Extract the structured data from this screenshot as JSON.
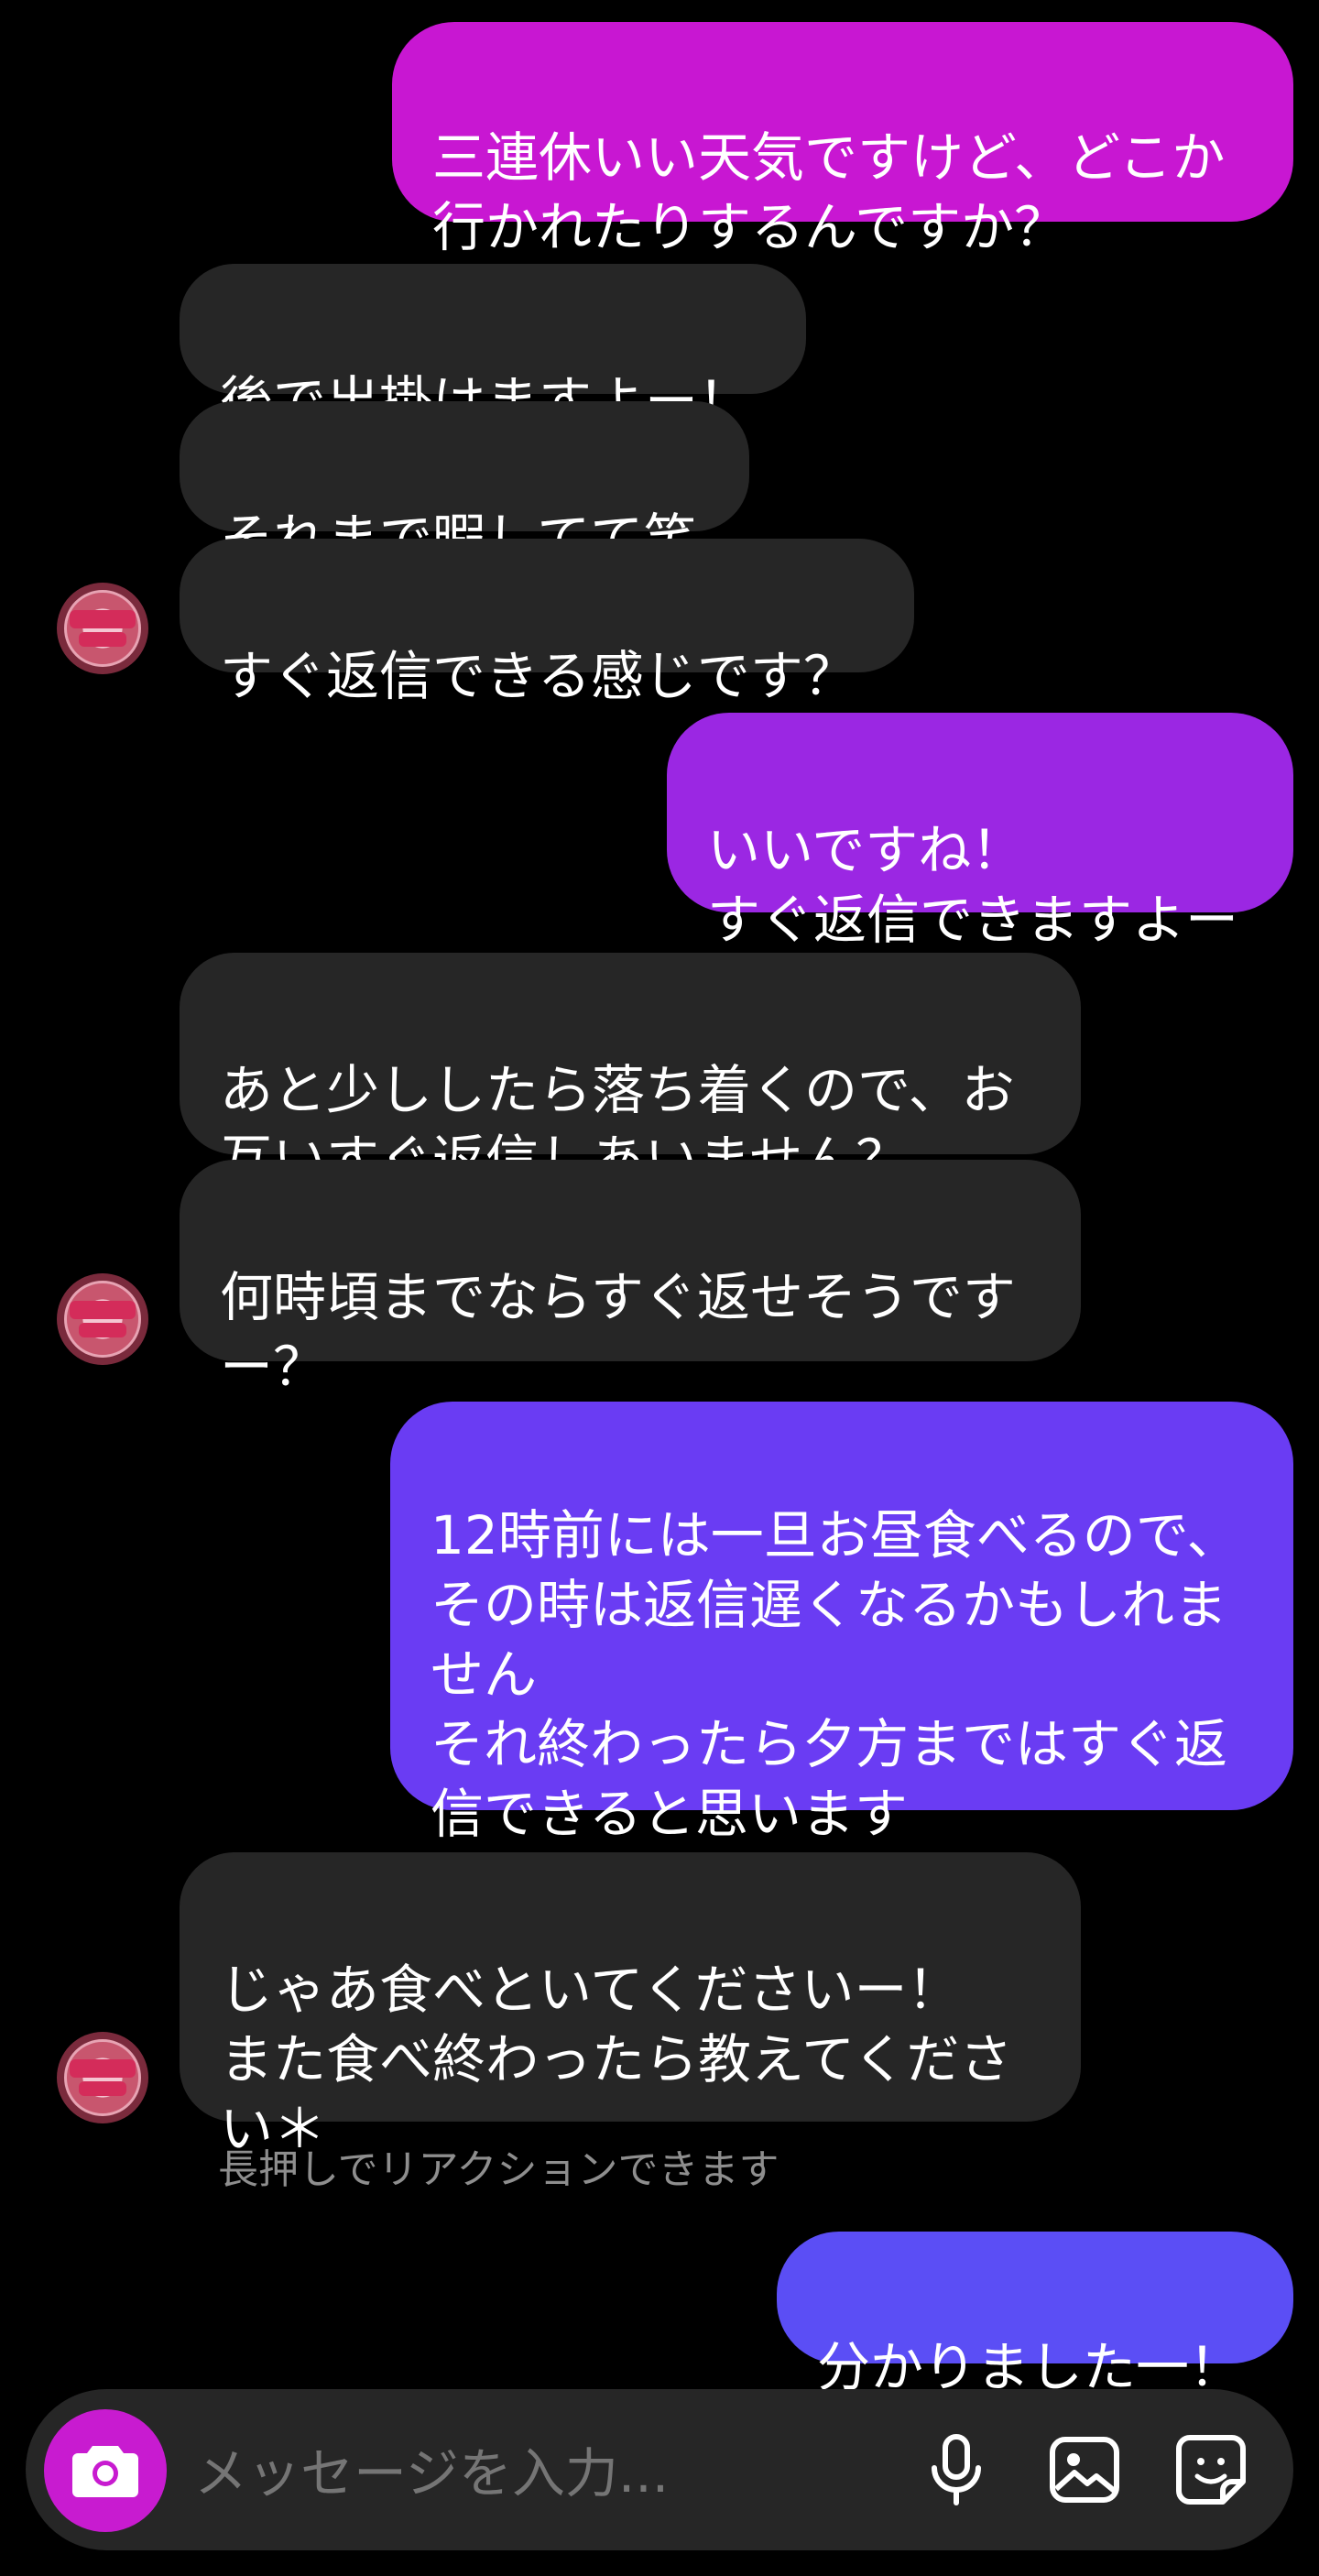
{
  "messages": {
    "m1": "三連休いい天気ですけど、どこか\n行かれたりするんですか？",
    "m2": "後で出掛けますよー！",
    "m3": "それまで暇してて笑",
    "m4": "すぐ返信できる感じです？",
    "m5": "いいですね！\nすぐ返信できますよー",
    "m6": "あと少ししたら落ち着くので、お\n互いすぐ返信しあいません？",
    "m7": "何時頃までならすぐ返せそうです\nー？",
    "m8": "12時前には一旦お昼食べるので、\nその時は返信遅くなるかもしれま\nせん\nそれ終わったら夕方まではすぐ返\n信できると思います",
    "m9": "じゃあ食べといてくださいー！\nまた食べ終わったら教えてくださ\nい＊",
    "m10": "分かりました一！"
  },
  "hint": "長押しでリアクションできます",
  "composer": {
    "placeholder": "メッセージを入力..."
  },
  "icons": {
    "camera": "camera-icon",
    "mic": "microphone-icon",
    "gallery": "image-icon",
    "sticker": "sticker-icon"
  },
  "colors": {
    "m1": "#c817d2",
    "m5": "#9b27e3",
    "m8": "#6a3cf3",
    "m10": "#5b4ef5",
    "incoming": "#262626",
    "camera": "#c81bd0"
  }
}
